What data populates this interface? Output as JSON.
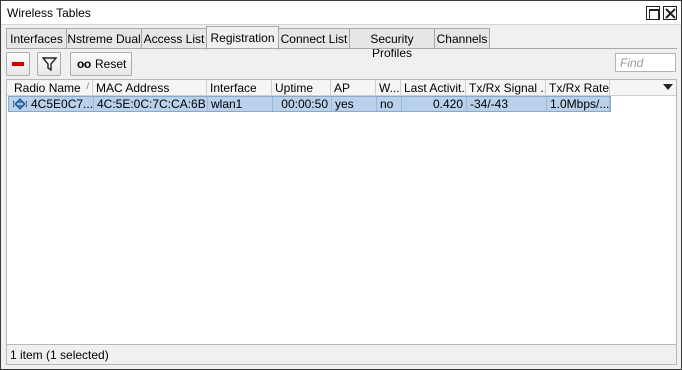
{
  "window": {
    "title": "Wireless Tables"
  },
  "tabs": [
    {
      "label": "Interfaces"
    },
    {
      "label": "Nstreme Dual"
    },
    {
      "label": "Access List"
    },
    {
      "label": "Registration",
      "active": true
    },
    {
      "label": "Connect List"
    },
    {
      "label": "Security Profiles"
    },
    {
      "label": "Channels"
    }
  ],
  "toolbar": {
    "remove_icon": "minus-icon",
    "filter_icon": "funnel-icon",
    "reset_glyph": "oo",
    "reset_label": "Reset",
    "find_placeholder": "Find"
  },
  "table": {
    "columns": [
      {
        "label": "Radio Name",
        "sorted": true
      },
      {
        "label": "MAC Address"
      },
      {
        "label": "Interface"
      },
      {
        "label": "Uptime"
      },
      {
        "label": "AP"
      },
      {
        "label": "W..."
      },
      {
        "label": "Last Activit..."
      },
      {
        "label": "Tx/Rx Signal ..."
      },
      {
        "label": "Tx/Rx Rate"
      }
    ],
    "sort_indicator": "/",
    "rows": [
      {
        "selected": true,
        "radio_name": "4C5E0C7...",
        "mac_address": "4C:5E:0C:7C:CA:6B",
        "interface": "wlan1",
        "uptime": "00:00:50",
        "ap": "yes",
        "wds": "no",
        "last_activity": "0.420",
        "signal": "-34/-43",
        "rate": "1.0Mbps/..."
      }
    ]
  },
  "status": {
    "text": "1 item (1 selected)"
  },
  "colors": {
    "selection": "#b9d1ea",
    "remove": "#d10000"
  }
}
